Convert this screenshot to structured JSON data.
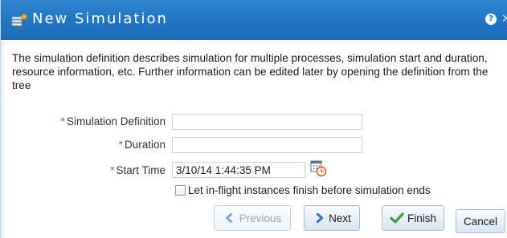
{
  "dialog": {
    "title": "New Simulation",
    "title_icon": "new-simulation-icon",
    "help_icon_glyph": "?",
    "close_icon_glyph": "×",
    "description": "The simulation definition describes simulation for multiple processes, simulation start and duration, resource information, etc. Further information can be edited later by opening the definition from the tree"
  },
  "form": {
    "required_marker": "*",
    "simulation_definition": {
      "label": "Simulation Definition",
      "value": ""
    },
    "duration": {
      "label": "Duration",
      "value": ""
    },
    "start_time": {
      "label": "Start Time",
      "value": "3/10/14 1:44:35 PM",
      "picker_icon": "date-time-picker-icon"
    },
    "let_finish": {
      "label": "Let in-flight instances finish before simulation ends",
      "checked": false
    }
  },
  "buttons": {
    "previous": {
      "label": "Previous",
      "icon": "chevron-left-icon",
      "enabled": false
    },
    "next": {
      "label": "Next",
      "icon": "chevron-right-icon",
      "enabled": true
    },
    "finish": {
      "label": "Finish",
      "icon": "checkmark-icon",
      "enabled": true
    },
    "cancel": {
      "label": "Cancel",
      "enabled": true
    }
  },
  "colors": {
    "titlebar": "#2378c4",
    "required_marker": "#3c7fb8",
    "chevron": "#2e78c8",
    "checkmark": "#3aa23a"
  }
}
